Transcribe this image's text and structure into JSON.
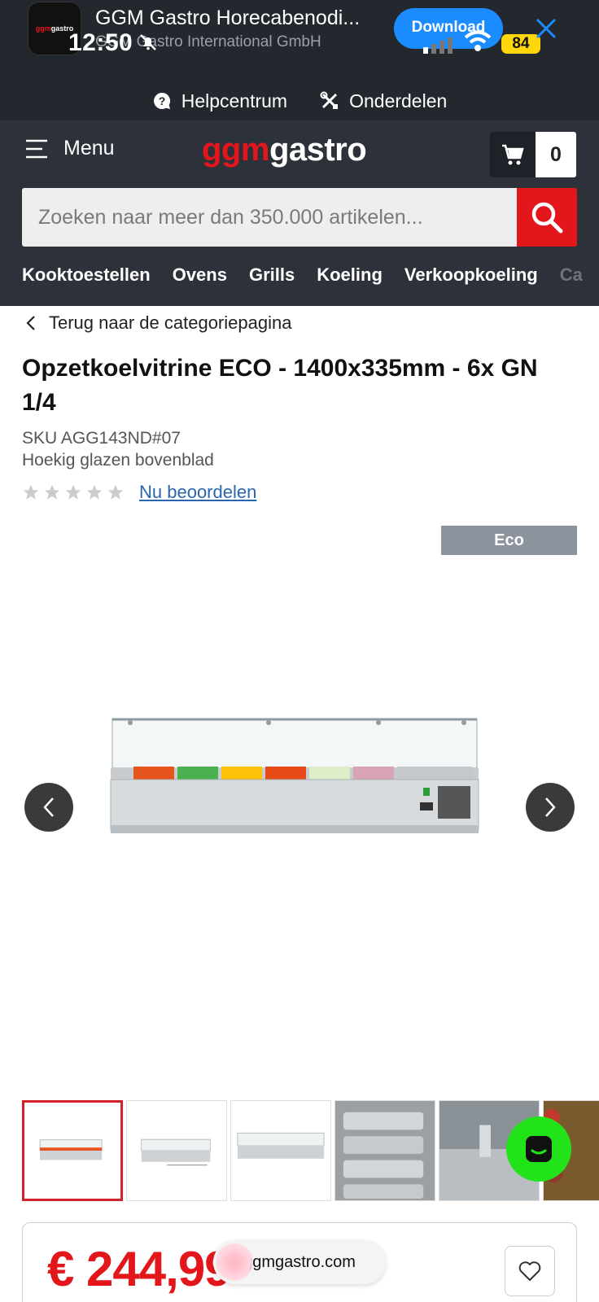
{
  "banner": {
    "app_title": "GGM Gastro Horecabenodi...",
    "app_subtitle": "GGM Gastro International GmbH",
    "download_label": "Download",
    "icon_text_red": "ggm",
    "icon_text_white": "gastro"
  },
  "status_bar": {
    "time": "12:50",
    "battery": "84"
  },
  "help_links": [
    {
      "label": "Helpcentrum",
      "icon": "help-bubble-icon"
    },
    {
      "label": "Onderdelen",
      "icon": "tools-icon"
    }
  ],
  "header": {
    "menu_label": "Menu",
    "logo_red": "ggm",
    "logo_white": "gastro",
    "cart_count": "0"
  },
  "search": {
    "placeholder": "Zoeken naar meer dan 350.000 artikelen..."
  },
  "categories": [
    "Kooktoestellen",
    "Ovens",
    "Grills",
    "Koeling",
    "Verkoopkoeling",
    "Ca"
  ],
  "product": {
    "back_label": "Terug naar de categoriepagina",
    "title": "Opzetkoelvitrine ECO - 1400x335mm - 6x GN 1/4",
    "sku": "SKU AGG143ND#07",
    "subtitle": "Hoekig glazen bovenblad",
    "rating": 0,
    "review_label": "Nu beoordelen",
    "badge": "Eco",
    "price": "€ 244,99"
  },
  "browser": {
    "url": "ggmgastro.com"
  },
  "colors": {
    "brand_red": "#e3161b",
    "header_dark": "#2d3139",
    "chat_green": "#22e31a",
    "download_blue": "#1a8cff"
  }
}
